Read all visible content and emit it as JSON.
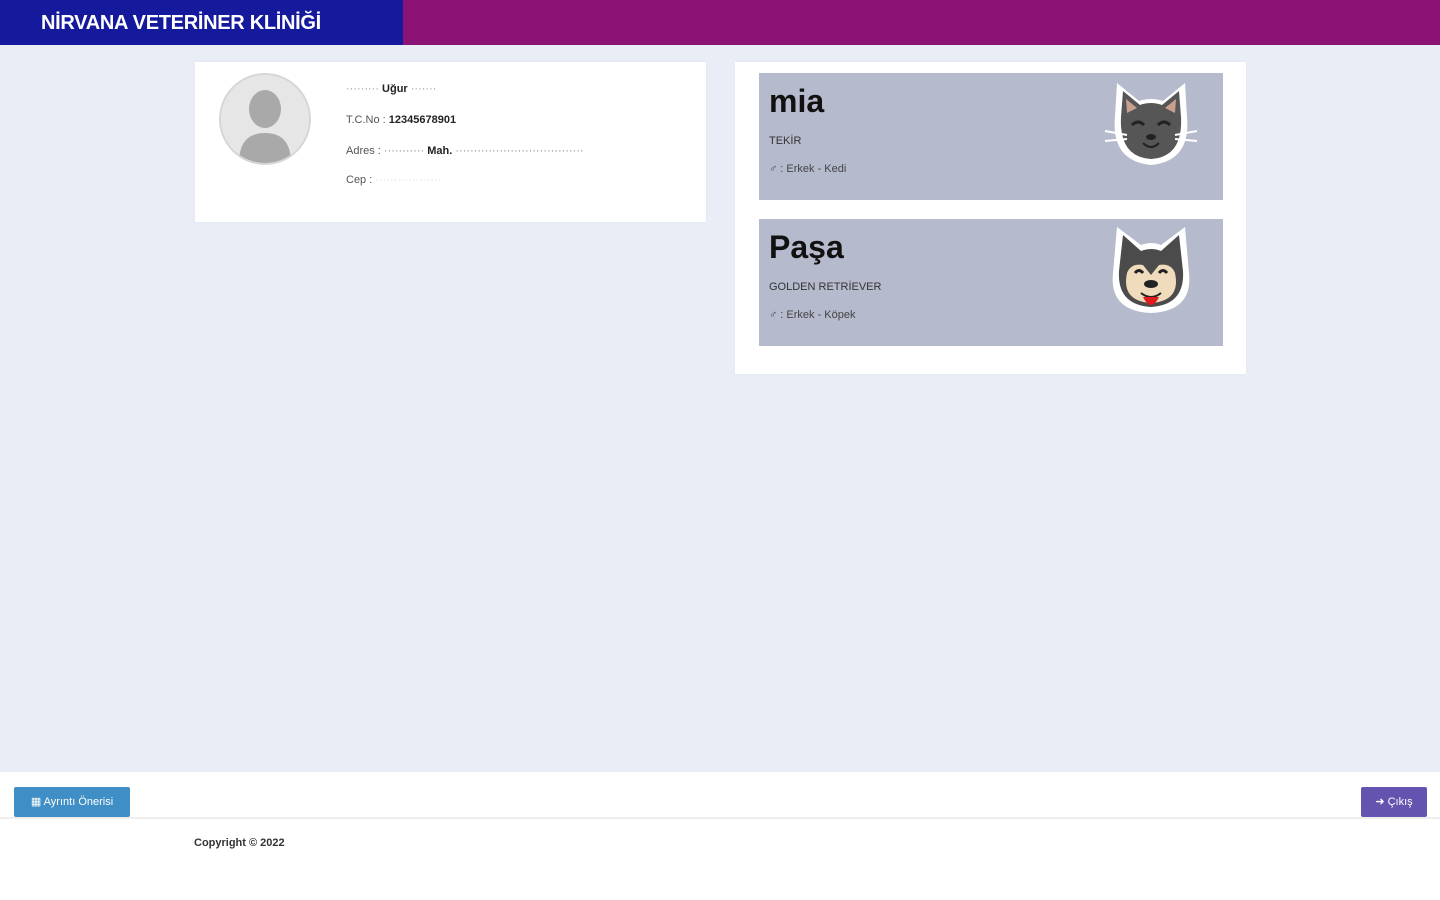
{
  "header": {
    "brand": "NİRVANA VETERİNER KLİNİĞİ"
  },
  "owner": {
    "name_line": "Uğur",
    "tc_label": "T.C.No : ",
    "tc_value": "12345678901",
    "address_label": "Adres : ",
    "address_value": "Mah.",
    "phone_label": "Cep : "
  },
  "pets": [
    {
      "name": "mia",
      "breed": "TEKİR",
      "meta": "♂ : Erkek - Kedi",
      "icon": "cat-icon"
    },
    {
      "name": "Paşa",
      "breed": "GOLDEN RETRİEVER",
      "meta": "♂ : Erkek - Köpek",
      "icon": "dog-icon"
    }
  ],
  "footer": {
    "appointment_button": "Ayrıntı Önerisi",
    "logout_button": "Çıkış",
    "copyright": "Copyright © 2022"
  },
  "colors": {
    "brand_bg": "#15199c",
    "topbar": "#8b1376",
    "pet_box": "#b6bacd"
  }
}
